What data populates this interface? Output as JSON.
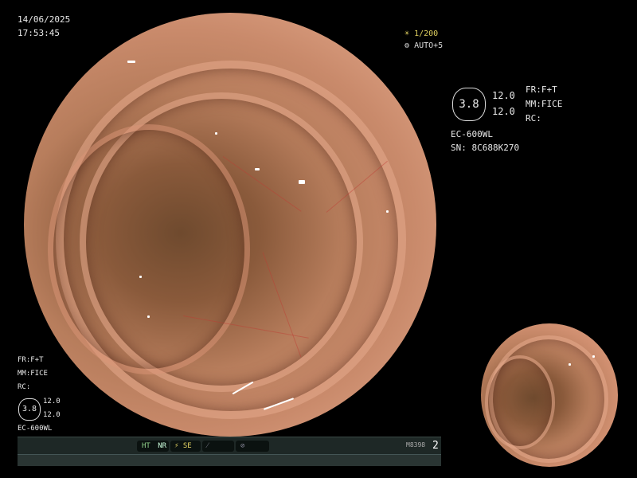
{
  "datetime": {
    "date": "14/06/2025",
    "time": "17:53:45"
  },
  "exposure": {
    "shutter": "1/200",
    "auto": "AUTO+5"
  },
  "info_right": {
    "zoom_box": "3.8",
    "val_a": "12.0",
    "val_b": "12.0",
    "fr": "FR:F+T",
    "mm": "MM:FICE",
    "rc": "RC:",
    "scope_model": "EC-600WL",
    "serial": "SN: 8C688K270"
  },
  "info_left": {
    "fr": "FR:F+T",
    "mm": "MM:FICE",
    "rc": "RC:",
    "zoom_box": "3.8",
    "val_a": "12.0",
    "val_b": "12.0",
    "scope_model": "EC-600WL"
  },
  "statusbar": {
    "ht": "HT",
    "nr": "NR",
    "se": "SE",
    "code": "M8398",
    "number": "2"
  },
  "colors": {
    "background": "#000000",
    "indicator_green": "#8fd08a",
    "exposure_yellow": "#e0d060"
  },
  "icons": {
    "exposure": "sun-icon",
    "auto": "gear-icon",
    "se": "sharpness-icon",
    "pen": "pen-icon",
    "circle": "circle-icon"
  }
}
